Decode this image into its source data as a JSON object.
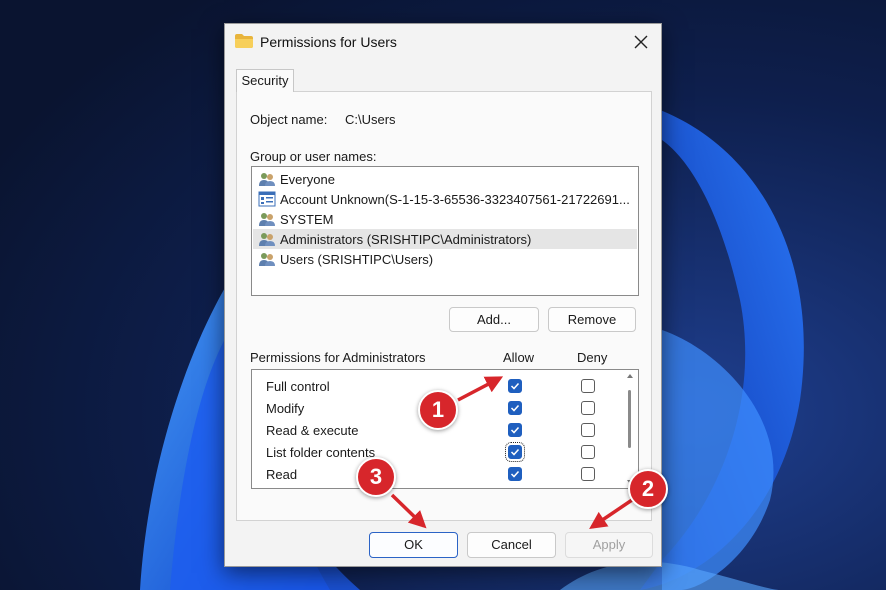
{
  "dialog": {
    "title": "Permissions for Users",
    "close_glyph": "✕",
    "tab_label": "Security",
    "object_name_label": "Object name:",
    "object_name_value": "C:\\Users",
    "group_label": "Group or user names:",
    "users": [
      {
        "name": "Everyone",
        "icon": "users-icon",
        "selected": false
      },
      {
        "name": "Account Unknown(S-1-15-3-65536-3323407561-21722691...",
        "icon": "unknown-account-icon",
        "selected": false
      },
      {
        "name": "SYSTEM",
        "icon": "users-icon",
        "selected": false
      },
      {
        "name": "Administrators (SRISHTIPC\\Administrators)",
        "icon": "users-icon",
        "selected": true
      },
      {
        "name": "Users (SRISHTIPC\\Users)",
        "icon": "users-icon",
        "selected": false
      }
    ],
    "add_button": "Add...",
    "remove_button": "Remove",
    "permissions_label": "Permissions for Administrators",
    "allow_header": "Allow",
    "deny_header": "Deny",
    "permissions": [
      {
        "name": "Full control",
        "allow": true,
        "deny": false
      },
      {
        "name": "Modify",
        "allow": true,
        "deny": false
      },
      {
        "name": "Read & execute",
        "allow": true,
        "deny": false
      },
      {
        "name": "List folder contents",
        "allow": true,
        "deny": false
      },
      {
        "name": "Read",
        "allow": true,
        "deny": false
      }
    ],
    "ok_button": "OK",
    "cancel_button": "Cancel",
    "apply_button": "Apply"
  },
  "annotations": [
    "1",
    "2",
    "3"
  ],
  "colors": {
    "accent": "#1f5fbf",
    "annotation": "#d7262b",
    "dialog_bg": "#f3f3f3"
  }
}
